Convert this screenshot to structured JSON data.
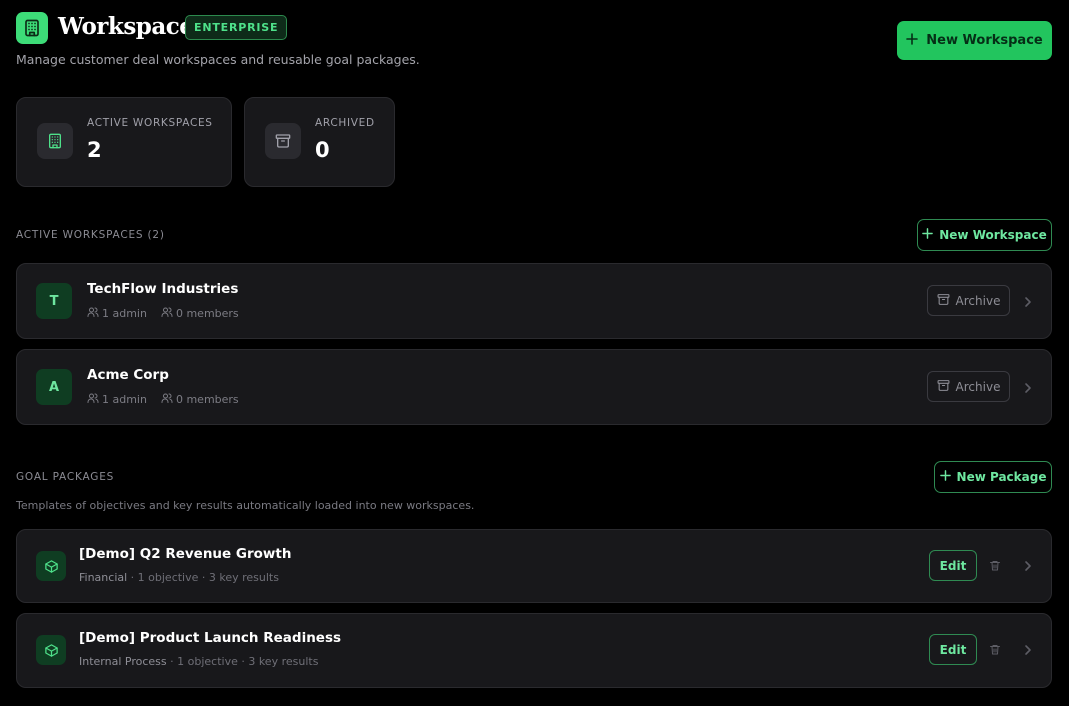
{
  "header": {
    "title": "Workspaces",
    "badge": "ENTERPRISE",
    "subtitle": "Manage customer deal workspaces and reusable goal packages.",
    "new_workspace_label": "New Workspace"
  },
  "stats": [
    {
      "label": "ACTIVE WORKSPACES",
      "value": "2",
      "icon": "building-icon"
    },
    {
      "label": "ARCHIVED",
      "value": "0",
      "icon": "archive-icon"
    }
  ],
  "workspaces_section": {
    "label": "ACTIVE WORKSPACES (2)",
    "button_label": "New Workspace",
    "items": [
      {
        "initial": "T",
        "name": "TechFlow Industries",
        "admins": "1 admin",
        "members": "0 members",
        "archive_label": "Archive"
      },
      {
        "initial": "A",
        "name": "Acme Corp",
        "admins": "1 admin",
        "members": "0 members",
        "archive_label": "Archive"
      }
    ]
  },
  "packages_section": {
    "label": "GOAL PACKAGES",
    "button_label": "New Package",
    "description": "Templates of objectives and key results automatically loaded into new workspaces.",
    "items": [
      {
        "name": "[Demo] Q2 Revenue Growth",
        "category": "Financial",
        "details": " · 1 objective · 3 key results",
        "edit_label": "Edit"
      },
      {
        "name": "[Demo] Product Launch Readiness",
        "category": "Internal Process",
        "details": " · 1 objective · 3 key results",
        "edit_label": "Edit"
      }
    ]
  },
  "colors": {
    "accent": "#22c55e",
    "accent_text": "#6ee7a0",
    "card_bg": "#18181b",
    "page_bg": "#000000"
  }
}
